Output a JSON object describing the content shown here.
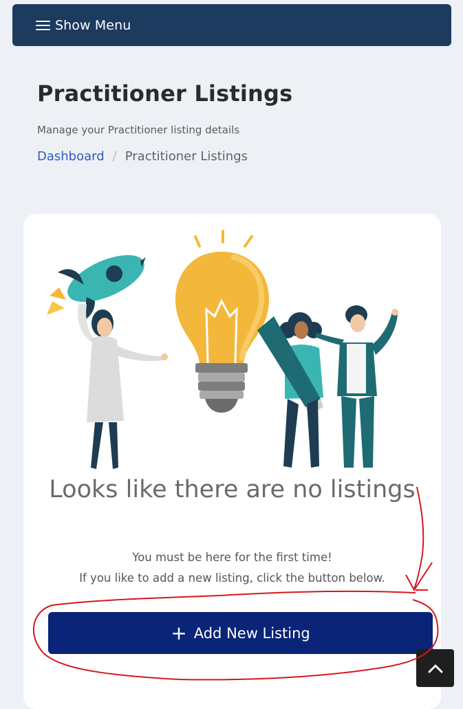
{
  "header": {
    "menu_label": "Show Menu"
  },
  "page": {
    "title": "Practitioner Listings",
    "subtitle": "Manage your Practitioner listing details"
  },
  "breadcrumb": {
    "home": "Dashboard",
    "separator": "/",
    "current": "Practitioner Listings"
  },
  "empty_state": {
    "title": "Looks like there are no listings",
    "line1": "You must be here for the first time!",
    "line2": "If you like to add a new listing, click the button below."
  },
  "actions": {
    "add_plus": "+",
    "add_label": "Add New Listing"
  },
  "colors": {
    "menu_bar": "#1d3a5f",
    "primary_button": "#0a2478",
    "link": "#2f5bbf",
    "annotation_red": "#d4181c"
  },
  "icons": {
    "menu": "hamburger-icon",
    "plus": "plus-icon",
    "scroll_top": "chevron-up-icon"
  }
}
